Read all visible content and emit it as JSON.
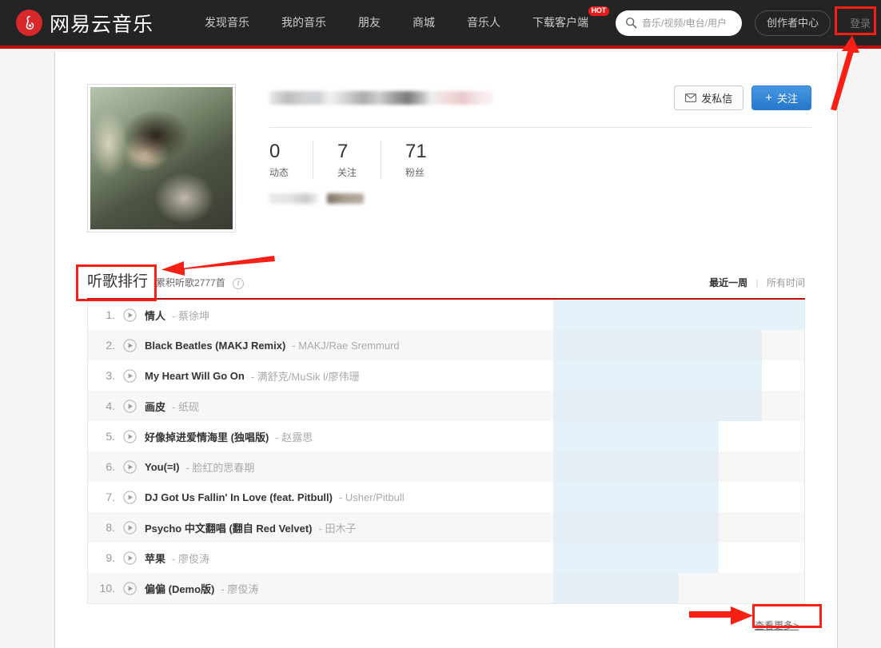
{
  "header": {
    "logo_text": "网易云音乐",
    "logo_icon": "netease-music-logo-icon",
    "nav": [
      {
        "label": "发现音乐",
        "badge": null
      },
      {
        "label": "我的音乐",
        "badge": null
      },
      {
        "label": "朋友",
        "badge": null
      },
      {
        "label": "商城",
        "badge": null
      },
      {
        "label": "音乐人",
        "badge": null
      },
      {
        "label": "下载客户端",
        "badge": "HOT"
      }
    ],
    "search": {
      "placeholder": "音乐/视频/电台/用户",
      "value": "",
      "icon": "search-icon"
    },
    "creator_label": "创作者中心",
    "login_label": "登录"
  },
  "profile": {
    "avatar_alt": "user-avatar-photo",
    "name_redacted": true,
    "message_button": "发私信",
    "message_icon": "envelope-icon",
    "follow_button": "关注",
    "follow_icon": "plus-icon",
    "stats": [
      {
        "value": "0",
        "label": "动态"
      },
      {
        "value": "7",
        "label": "关注"
      },
      {
        "value": "71",
        "label": "粉丝"
      }
    ],
    "tags_redacted": true
  },
  "ranking": {
    "title": "听歌排行",
    "subtitle": "累积听歌2777首",
    "info_icon": "info-icon",
    "period_active": "最近一周",
    "period_separator": "|",
    "period_inactive": "所有时间",
    "more_label": "查看更多>",
    "songs": [
      {
        "rank": "1.",
        "title": "情人",
        "dash": "-",
        "artist": "蔡徐坤",
        "pct": 100
      },
      {
        "rank": "2.",
        "title": "Black Beatles (MAKJ Remix)",
        "dash": "-",
        "artist": "MAKJ/Rae Sremmurd",
        "pct": 83
      },
      {
        "rank": "3.",
        "title": "My Heart Will Go On",
        "dash": "-",
        "artist": "满舒克/MuSik l/廖伟珊",
        "pct": 83
      },
      {
        "rank": "4.",
        "title": "画皮",
        "dash": "-",
        "artist": "纸砚",
        "pct": 83
      },
      {
        "rank": "5.",
        "title": "好像掉进爱情海里 (独唱版)",
        "dash": "-",
        "artist": "赵露思",
        "pct": 66
      },
      {
        "rank": "6.",
        "title": "You(=I)",
        "dash": "-",
        "artist": "脸红的思春期",
        "pct": 66
      },
      {
        "rank": "7.",
        "title": "DJ Got Us Fallin' In Love (feat. Pitbull)",
        "dash": "-",
        "artist": "Usher/Pitbull",
        "pct": 66
      },
      {
        "rank": "8.",
        "title": "Psycho 中文翻唱 (翻自 Red Velvet)",
        "dash": "-",
        "artist": "田木子",
        "pct": 66
      },
      {
        "rank": "9.",
        "title": "苹果",
        "dash": "-",
        "artist": "廖俊涛",
        "pct": 66
      },
      {
        "rank": "10.",
        "title": "偏偏 (Demo版)",
        "dash": "-",
        "artist": "廖俊涛",
        "pct": 50
      }
    ]
  },
  "annotations": {
    "color": "#f81f14",
    "items": [
      "login-button-highlight",
      "ranking-title-highlight",
      "more-link-highlight"
    ]
  },
  "colors": {
    "brand_red": "#c20c0c",
    "nav_bg": "#242424",
    "follow_blue": "#2477cc",
    "bar_blue": "#e6f2fa",
    "annotation_red": "#f81f14"
  }
}
